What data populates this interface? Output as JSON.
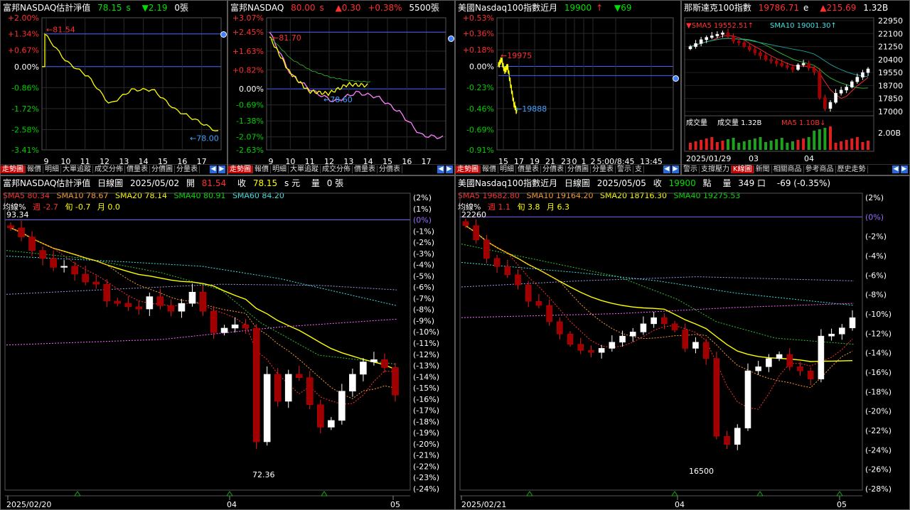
{
  "panels": {
    "p1": {
      "title": "富邦NASDAQ估計淨值",
      "price": "78.15",
      "suffix": "s",
      "change": "▼2.19",
      "volume": "0張",
      "y_ticks": [
        "+2.00%",
        "+1.34%",
        "+0.67%",
        "0.00%",
        "-0.86%",
        "-1.72%",
        "-2.58%",
        "-3.41%"
      ],
      "x_ticks": [
        "9",
        "10",
        "11",
        "12",
        "13",
        "14",
        "15",
        "16",
        "17"
      ],
      "marker_high": "81.54",
      "marker_low": "78.00"
    },
    "p2": {
      "title": "富邦NASDAQ",
      "price": "80.00",
      "suffix": "s",
      "change": "▲0.30",
      "pct": "+0.38%",
      "volume": "5500張",
      "y_ticks": [
        "+3.07%",
        "+2.45%",
        "+1.63%",
        "+0.82%",
        "0.00%",
        "-0.69%",
        "-1.38%",
        "-2.07%",
        "-2.63%"
      ],
      "x_ticks": [
        "9",
        "10",
        "11",
        "12",
        "13",
        "14",
        "15",
        "16",
        "17"
      ],
      "marker_high": "81.70",
      "marker_low": "78.60"
    },
    "p3": {
      "title": "美國Nasdaq100指數近月",
      "price": "19900",
      "change": "▼69",
      "up_arrow": "↑",
      "y_ticks": [
        "+0.53%",
        "+0.36%",
        "+0.18%",
        "0.00%",
        "-0.23%",
        "-0.46%",
        "-0.69%",
        "-0.91%"
      ],
      "x_ticks": [
        "15",
        "17",
        "19",
        "21",
        "23",
        "0",
        "1",
        "2",
        "5:00/8:45",
        "13:45"
      ],
      "marker_high": "19975",
      "marker_low": "19888"
    },
    "p4": {
      "title": "那斯達克100指數",
      "price": "19786.71",
      "suffix": "e",
      "change": "▲215.69",
      "volume": "1.32B",
      "sma5": "SMA5 19552.51",
      "sma10": "SMA10 19001.30",
      "y_ticks": [
        "22950",
        "22100",
        "21250",
        "20400",
        "19550",
        "18700",
        "17850",
        "17000"
      ],
      "vol_title": "成交量",
      "vol_val": "成交量 1.32B",
      "vol_ma": "MA5 1.10B",
      "vol_tick": "2.00B",
      "x_ticks": [
        "2025/01/29",
        "03",
        "04"
      ]
    },
    "p5": {
      "title": "富邦NASDAQ估計淨值",
      "chart_type": "日線圖",
      "date": "2025/05/02",
      "open_lbl": "開",
      "open": "81.54",
      "close_lbl": "收",
      "close": "78.15",
      "close_unit": "s 元",
      "vol_lbl": "量",
      "vol": "0 張",
      "sma5": "SMA5 80.34",
      "sma10": "SMA10 78.67",
      "sma20": "SMA20 78.14",
      "sma40": "SMA40 80.91",
      "sma60": "SMA60 84.20",
      "avg_lbl": "均線%",
      "week": "週 -2.7",
      "ten": "旬 -0.7",
      "month": "月 0.0",
      "high_label": "93.34",
      "low_label": "72.36",
      "x_ticks": [
        "2025/02/20",
        "04",
        "05"
      ]
    },
    "p6": {
      "title": "美國Nasdaq100指數近月",
      "chart_type": "日線圖",
      "date": "2025/05/05",
      "close_lbl": "收",
      "close": "19900",
      "unit": "點",
      "vol_lbl": "量",
      "vol": "349 口",
      "chg": "-69 (-0.35%)",
      "sma5": "SMA5 19682.80",
      "sma10": "SMA10 19164.20",
      "sma20": "SMA20 18716.30",
      "sma40": "SMA40 19275.53",
      "avg_lbl": "均線%",
      "week": "週 1.1",
      "ten": "旬 3.8",
      "month": "月 6.3",
      "high_label": "22260",
      "low_label": "16500",
      "x_ticks": [
        "2025/02/21",
        "04",
        "05"
      ]
    }
  },
  "tabs": {
    "p1": [
      "走勢圖",
      "報價",
      "明細",
      "大單追蹤",
      "成交分佈",
      "價量表",
      "分價圖",
      "分量表"
    ],
    "p2": [
      "走勢圖",
      "報價",
      "明細",
      "大單追蹤",
      "成交分佈",
      "價量表",
      "分價表"
    ],
    "p3": [
      "走勢圖",
      "報價",
      "明細",
      "價量表",
      "分價表",
      "分價圖",
      "分量表",
      "警示",
      "支"
    ],
    "p4": [
      "警示",
      "支撐壓力",
      "K線圖",
      "新聞",
      "相關商品",
      "參考商品",
      "歷史走勢"
    ]
  },
  "axis_pct_5": [
    "(2%)",
    "(1%)",
    "(0%)",
    "(-1%)",
    "(-2%)",
    "(-3%)",
    "(-4%)",
    "(-5%)",
    "(-6%)",
    "(-7%)",
    "(-8%)",
    "(-9%)",
    "(-10%)",
    "(-11%)",
    "(-12%)",
    "(-13%)",
    "(-14%)",
    "(-15%)",
    "(-16%)",
    "(-17%)",
    "(-18%)",
    "(-19%)",
    "(-20%)",
    "(-21%)",
    "(-22%)",
    "(-23%)",
    "(-24%)"
  ],
  "axis_pct_6": [
    "(2%)",
    "(0%)",
    "(-2%)",
    "(-4%)",
    "(-6%)",
    "(-8%)",
    "(-10%)",
    "(-12%)",
    "(-14%)",
    "(-16%)",
    "(-18%)",
    "(-20%)",
    "(-22%)",
    "(-24%)",
    "(-26%)",
    "(-28%)"
  ],
  "chart_data": [
    {
      "type": "line",
      "title": "富邦NASDAQ估計淨值",
      "x": [
        "9",
        "10",
        "11",
        "12",
        "13",
        "14",
        "15",
        "16",
        "17"
      ],
      "series": [
        {
          "values": [
            1.34,
            0.2,
            -0.4,
            -1.55,
            -0.95,
            -0.95,
            -1.75,
            -2.2,
            -2.68
          ]
        }
      ],
      "ylim": [
        -3.41,
        2.0
      ]
    },
    {
      "type": "line",
      "title": "富邦NASDAQ",
      "x": [
        "9",
        "10",
        "11",
        "12",
        "13",
        "14",
        "15",
        "16",
        "17"
      ],
      "series": [
        {
          "values": [
            2.45,
            0.6,
            -0.1,
            -0.55,
            -0.15,
            -0.35,
            -1.0,
            -2.0,
            -2.1
          ]
        },
        {
          "values": [
            2.25,
            0.75,
            -0.1,
            -0.2,
            0.2,
            0.15
          ]
        }
      ],
      "ylim": [
        -2.63,
        3.07
      ]
    },
    {
      "type": "line",
      "title": "美國Nasdaq100指數近月",
      "x": [
        "15",
        "16",
        "17"
      ],
      "series": [
        {
          "values": [
            0.05,
            -0.05,
            -0.46
          ]
        }
      ],
      "ylim": [
        -0.91,
        0.53
      ]
    },
    {
      "type": "candlestick",
      "title": "那斯達克100指數",
      "ylim": [
        17000,
        22950
      ],
      "closes": [
        21250,
        21450,
        21700,
        21850,
        21950,
        22050,
        22150,
        21900,
        21600,
        21500,
        21250,
        21050,
        20850,
        20650,
        20400,
        20300,
        20150,
        20000,
        19900,
        19750,
        20050,
        20150,
        19850,
        19600,
        17900,
        17200,
        17600,
        18200,
        18400,
        18600,
        18950,
        19250,
        19550,
        19786.71
      ]
    },
    {
      "type": "candlestick",
      "title": "富邦NASDAQ估計淨值 日線圖",
      "ylim": [
        72.36,
        93.34
      ],
      "closes": [
        93.0,
        92.2,
        91.0,
        90.3,
        89.5,
        89.6,
        88.9,
        88.2,
        88.0,
        86.5,
        86.3,
        86.0,
        85.8,
        86.9,
        86.1,
        85.6,
        86.3,
        87.3,
        85.6,
        83.7,
        84.1,
        84.4,
        84.1,
        74.0,
        80.0,
        77.6,
        80.0,
        79.7,
        77.3,
        75.3,
        75.9,
        78.5,
        80.0,
        81.1,
        81.3,
        80.6,
        78.15
      ]
    },
    {
      "type": "candlestick",
      "title": "美國Nasdaq100指數近月 日線圖",
      "ylim": [
        16500,
        22260
      ],
      "closes": [
        22150,
        21800,
        21350,
        21150,
        20950,
        20700,
        20300,
        20200,
        19800,
        19500,
        19250,
        19100,
        19050,
        19150,
        19300,
        19450,
        19550,
        19750,
        19900,
        19750,
        19600,
        19150,
        19300,
        18900,
        17000,
        16800,
        17200,
        18600,
        18700,
        18900,
        19000,
        18700,
        18600,
        18400,
        19450,
        19500,
        19650,
        19900
      ]
    }
  ]
}
